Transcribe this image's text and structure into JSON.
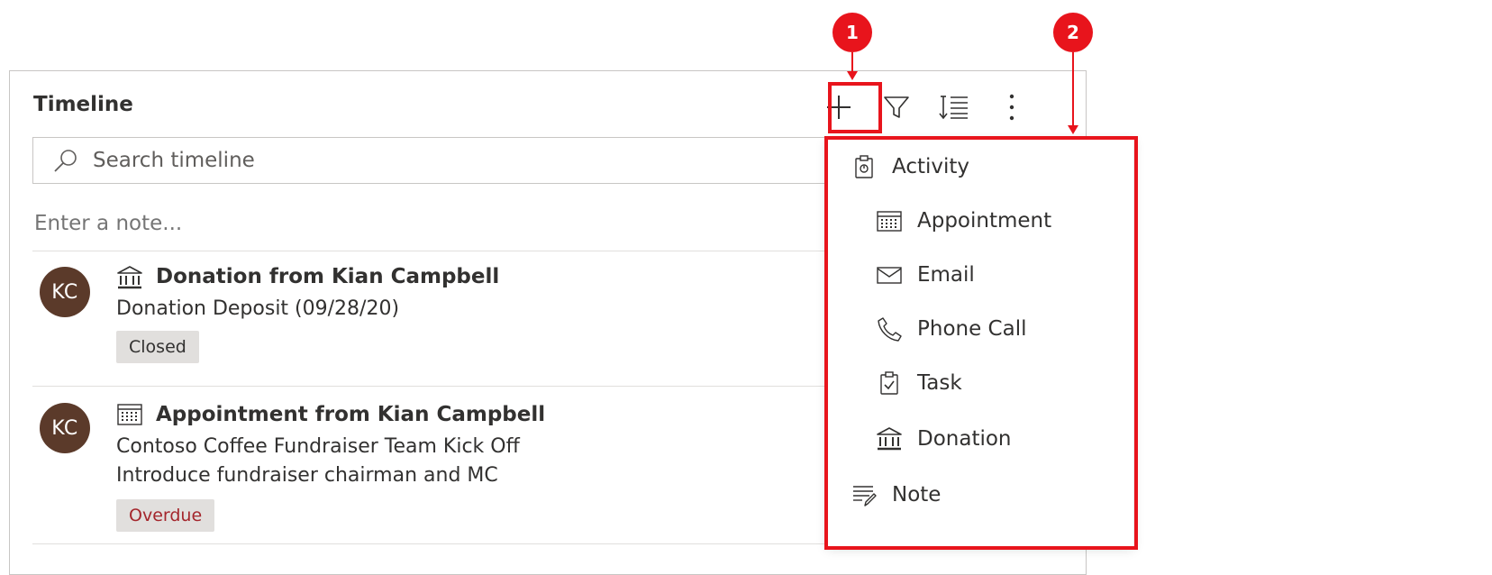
{
  "timeline": {
    "title": "Timeline",
    "search_placeholder": "Search timeline",
    "note_placeholder": "Enter a note...",
    "toolbar": {
      "add_icon": "plus-icon",
      "filter_icon": "filter-icon",
      "sort_icon": "sort-icon",
      "more_icon": "more-vertical-icon"
    },
    "items": [
      {
        "avatar": "KC",
        "type_icon": "bank-icon",
        "title": "Donation from Kian Campbell",
        "lines": [
          "Donation Deposit (09/28/20)"
        ],
        "badge": "Closed",
        "badge_color": "#323130"
      },
      {
        "avatar": "KC",
        "type_icon": "calendar-icon",
        "title": "Appointment from Kian Campbell",
        "lines": [
          "Contoso Coffee Fundraiser Team Kick Off",
          "Introduce fundraiser chairman and MC"
        ],
        "badge": "Overdue",
        "badge_color": "#a4262c"
      }
    ]
  },
  "menu": {
    "items": [
      {
        "label": "Activity",
        "icon": "activity-icon",
        "indent": false
      },
      {
        "label": "Appointment",
        "icon": "calendar-icon",
        "indent": true
      },
      {
        "label": "Email",
        "icon": "mail-icon",
        "indent": true
      },
      {
        "label": "Phone Call",
        "icon": "phone-icon",
        "indent": true
      },
      {
        "label": "Task",
        "icon": "task-icon",
        "indent": true
      },
      {
        "label": "Donation",
        "icon": "bank-icon",
        "indent": true
      },
      {
        "label": "Note",
        "icon": "note-icon",
        "indent": false
      }
    ]
  },
  "callouts": {
    "one": "1",
    "two": "2",
    "color": "#e8141c"
  },
  "colors": {
    "avatar_bg": "#5b3a2a",
    "badge_bg": "#e1dfdd"
  }
}
